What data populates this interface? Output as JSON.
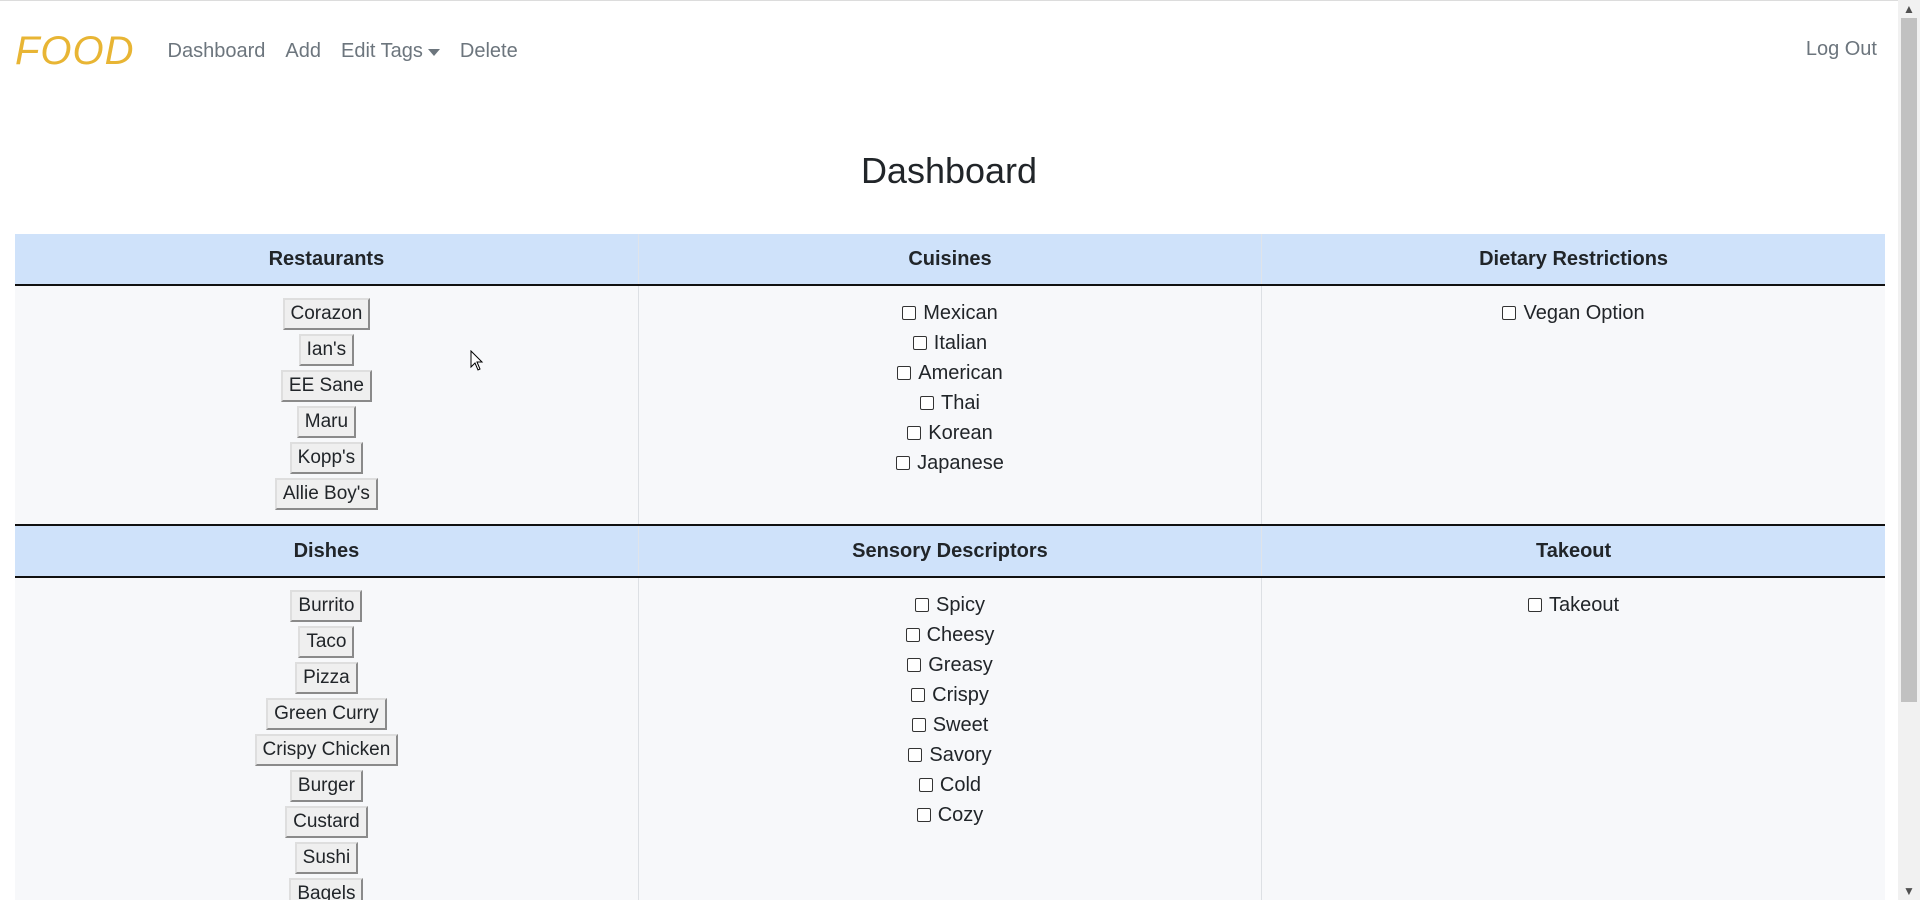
{
  "navbar": {
    "brand": "FOOD",
    "links": {
      "dashboard": "Dashboard",
      "add": "Add",
      "edit_tags": "Edit Tags",
      "delete": "Delete"
    },
    "logout": "Log Out"
  },
  "page_title": "Dashboard",
  "section1": {
    "headers": {
      "restaurants": "Restaurants",
      "cuisines": "Cuisines",
      "dietary": "Dietary Restrictions"
    },
    "restaurants": [
      "Corazon",
      "Ian's",
      "EE Sane",
      "Maru",
      "Kopp's",
      "Allie Boy's"
    ],
    "cuisines": [
      "Mexican",
      "Italian",
      "American",
      "Thai",
      "Korean",
      "Japanese"
    ],
    "dietary": [
      "Vegan Option"
    ]
  },
  "section2": {
    "headers": {
      "dishes": "Dishes",
      "sensory": "Sensory Descriptors",
      "takeout": "Takeout"
    },
    "dishes": [
      "Burrito",
      "Taco",
      "Pizza",
      "Green Curry",
      "Crispy Chicken",
      "Burger",
      "Custard",
      "Sushi",
      "Bagels"
    ],
    "sensory": [
      "Spicy",
      "Cheesy",
      "Greasy",
      "Crispy",
      "Sweet",
      "Savory",
      "Cold",
      "Cozy"
    ],
    "takeout": [
      "Takeout"
    ]
  },
  "icons": {
    "caret": "caret-down-icon",
    "scroll_up": "chevron-up-icon",
    "scroll_down": "chevron-down-icon",
    "cursor": "mouse-pointer-icon"
  },
  "colors": {
    "brand": "#e8b534",
    "header_bg": "#cfe2fa",
    "cell_bg": "#f7f8fa",
    "nav_text": "#6c757d"
  }
}
